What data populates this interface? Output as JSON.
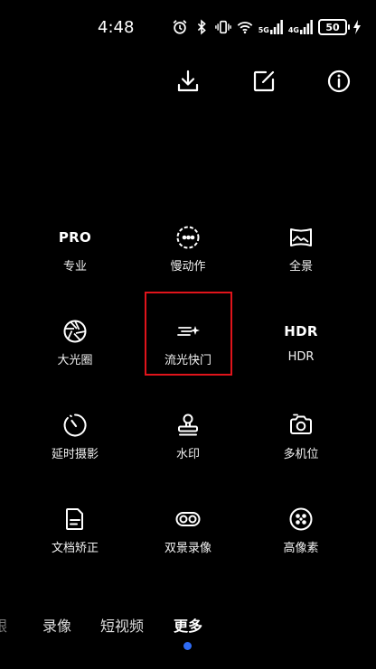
{
  "status": {
    "time": "4:48",
    "signal_5g": "5G",
    "signal_4g": "4G",
    "battery": "50"
  },
  "toolbar": {
    "download_icon": "download-icon",
    "edit_icon": "edit-icon",
    "info_icon": "info-icon"
  },
  "modes": [
    {
      "icon_text": "PRO",
      "label": "专业",
      "icon": "pro-text-icon"
    },
    {
      "label": "慢动作",
      "icon": "slow-motion-icon"
    },
    {
      "label": "全景",
      "icon": "panorama-icon"
    },
    {
      "label": "大光圈",
      "icon": "aperture-icon"
    },
    {
      "label": "流光快门",
      "icon": "light-trail-icon"
    },
    {
      "icon_text": "HDR",
      "label": "HDR",
      "icon": "hdr-text-icon"
    },
    {
      "label": "延时摄影",
      "icon": "timelapse-icon"
    },
    {
      "label": "水印",
      "icon": "stamp-icon"
    },
    {
      "label": "多机位",
      "icon": "multi-camera-icon"
    },
    {
      "label": "文档矫正",
      "icon": "document-icon"
    },
    {
      "label": "双景录像",
      "icon": "dual-view-icon"
    },
    {
      "label": "高像素",
      "icon": "high-pixel-icon"
    }
  ],
  "mode_bar": {
    "partial": "跟",
    "video": "录像",
    "short_video": "短视频",
    "more": "更多"
  },
  "colors": {
    "highlight": "#e0141b",
    "indicator": "#2f6cf6"
  }
}
